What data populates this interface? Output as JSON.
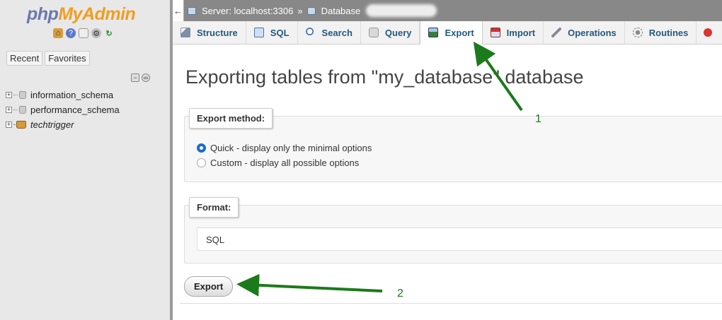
{
  "sidebar": {
    "logo_php": "php",
    "logo_admin": "MyAdmin",
    "recent_label": "Recent",
    "favorites_label": "Favorites",
    "databases": [
      {
        "name": "information_schema"
      },
      {
        "name": "performance_schema"
      },
      {
        "name": "techtrigger"
      }
    ]
  },
  "topbar": {
    "back_glyph": "←",
    "server_label": "Server: localhost:3306",
    "separator": "»",
    "database_label": "Database"
  },
  "tabs": [
    {
      "label": "Structure",
      "icon": "structure-icon"
    },
    {
      "label": "SQL",
      "icon": "sql-icon"
    },
    {
      "label": "Search",
      "icon": "search-icon"
    },
    {
      "label": "Query",
      "icon": "query-icon"
    },
    {
      "label": "Export",
      "icon": "export-icon",
      "active": true
    },
    {
      "label": "Import",
      "icon": "import-icon"
    },
    {
      "label": "Operations",
      "icon": "operations-icon"
    },
    {
      "label": "Routines",
      "icon": "routines-icon"
    }
  ],
  "main": {
    "title": "Exporting tables from \"my_database\" database",
    "export_method": {
      "legend": "Export method:",
      "options": [
        {
          "label": "Quick - display only the minimal options",
          "checked": true
        },
        {
          "label": "Custom - display all possible options",
          "checked": false
        }
      ]
    },
    "format": {
      "legend": "Format:",
      "selected": "SQL"
    },
    "export_button": "Export"
  },
  "annotations": {
    "one": "1",
    "two": "2",
    "color": "#1b7a1b"
  }
}
